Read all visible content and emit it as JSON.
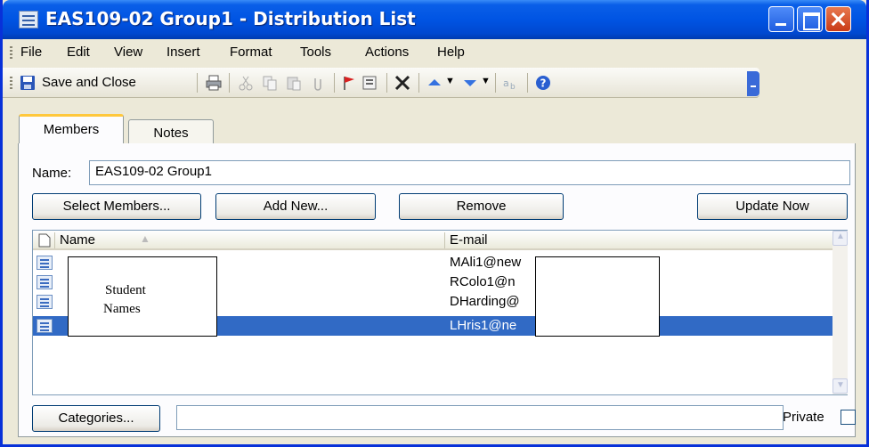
{
  "window": {
    "title": "EAS109-02 Group1  - Distribution List"
  },
  "menu": [
    "File",
    "Edit",
    "View",
    "Insert",
    "Format",
    "Tools",
    "Actions",
    "Help"
  ],
  "toolbar": {
    "save_label": "Save and Close",
    "icons": [
      "save-icon",
      "print-icon",
      "cut-icon",
      "copy-icon",
      "paste-icon",
      "attach-icon",
      "flag-icon",
      "categories-icon",
      "delete-icon",
      "previous-item-icon",
      "next-item-icon",
      "translate-icon",
      "help-icon"
    ]
  },
  "tabs": [
    {
      "label": "Members",
      "active": true
    },
    {
      "label": "Notes",
      "active": false
    }
  ],
  "form": {
    "name_label": "Name:",
    "name_value": "EAS109-02 Group1",
    "buttons": {
      "select_members": "Select Members...",
      "add_new": "Add New...",
      "remove": "Remove",
      "update_now": "Update Now"
    },
    "categories_button": "Categories...",
    "categories_value": "",
    "private_label": "Private",
    "private_checked": false
  },
  "list": {
    "columns": [
      "Name",
      "E-mail"
    ],
    "rows": [
      {
        "name": "",
        "email": "MAli1@new"
      },
      {
        "name": "",
        "email": "RColo1@n"
      },
      {
        "name": "",
        "email": "DHarding@"
      },
      {
        "name": "",
        "email": "LHris1@ne",
        "selected": true
      }
    ]
  },
  "annotation": {
    "line1": "Student",
    "line2": "Names"
  }
}
